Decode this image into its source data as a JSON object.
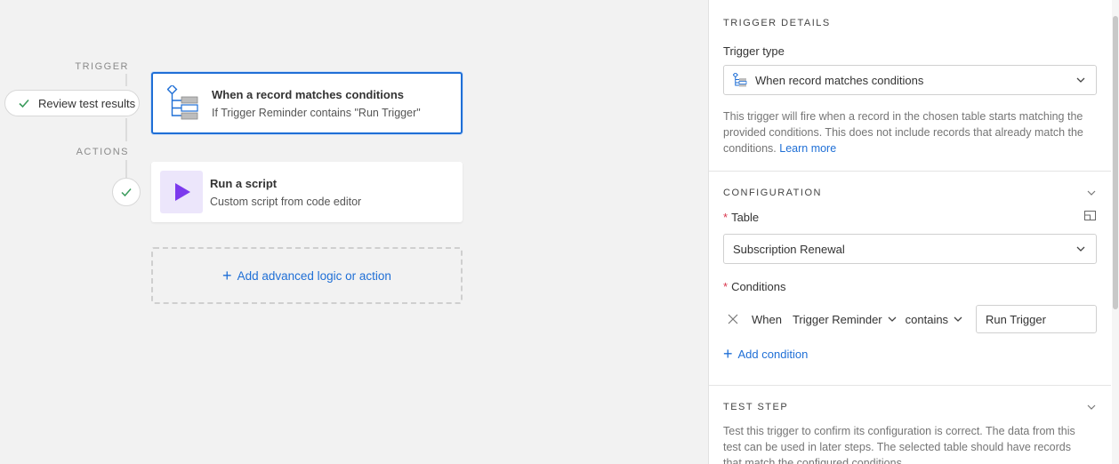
{
  "canvas": {
    "trigger_label": "TRIGGER",
    "actions_label": "ACTIONS",
    "review_pill": "Review test results",
    "trigger_card": {
      "title": "When a record matches conditions",
      "subtitle": "If Trigger Reminder contains \"Run Trigger\"",
      "icon": "record-conditions-icon"
    },
    "action_card": {
      "title": "Run a script",
      "subtitle": "Custom script from code editor",
      "icon": "play-script-icon"
    },
    "add_logic": "Add advanced logic or action"
  },
  "panel": {
    "trigger_details": {
      "heading": "TRIGGER DETAILS",
      "type_label": "Trigger type",
      "type_value": "When record matches conditions",
      "description": "This trigger will fire when a record in the chosen table starts matching the provided conditions. This does not include records that already match the conditions.",
      "learn_more": "Learn more"
    },
    "configuration": {
      "heading": "CONFIGURATION",
      "table_label": "Table",
      "table_value": "Subscription Renewal",
      "conditions_label": "Conditions",
      "condition": {
        "when": "When",
        "field": "Trigger Reminder",
        "operator": "contains",
        "value": "Run Trigger"
      },
      "add_condition": "Add condition"
    },
    "test_step": {
      "heading": "TEST STEP",
      "description": "Test this trigger to confirm its configuration is correct. The data from this test can be used in later steps. The selected table should have records that match the configured conditions."
    }
  },
  "colors": {
    "accent": "#1f6fd6",
    "required": "#d9354c",
    "script_purple": "#7c3aed"
  }
}
